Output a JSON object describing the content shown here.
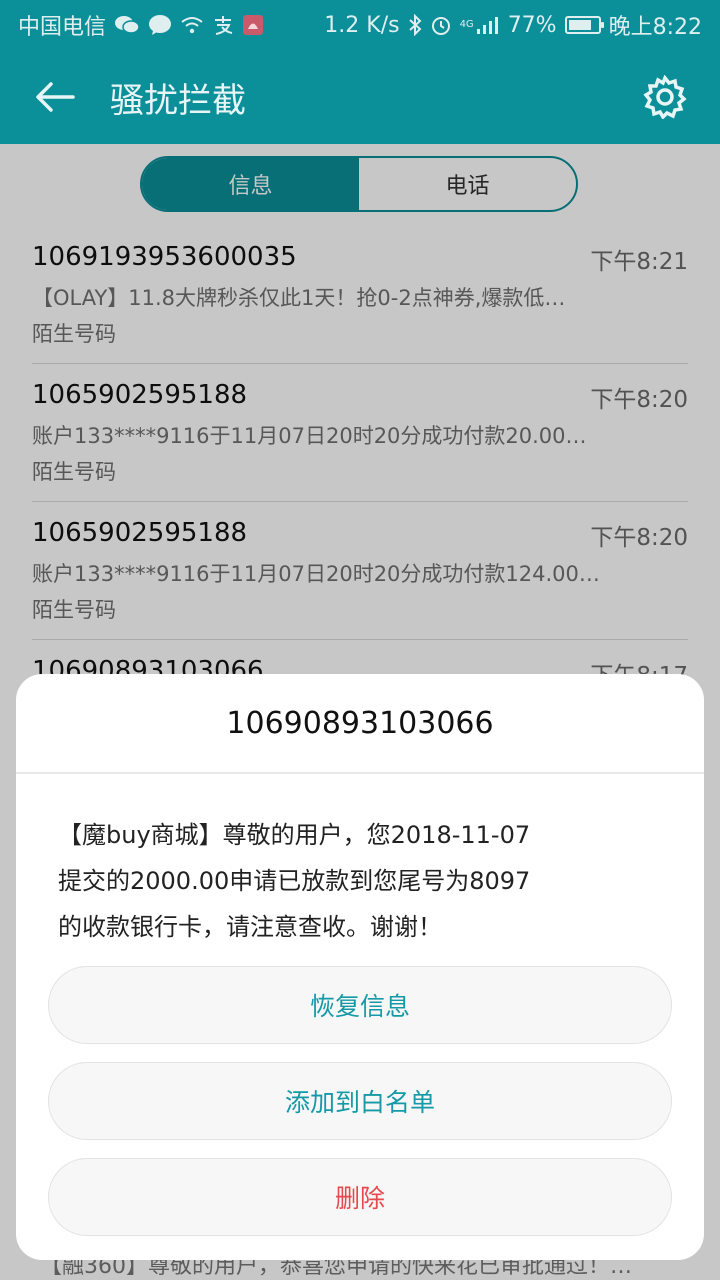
{
  "statusbar": {
    "carrier": "中国电信",
    "net_speed": "1.2 K/s",
    "network": "4G",
    "battery_text": "77%",
    "battery_level": 0.77,
    "time": "晚上8:22"
  },
  "toolbar": {
    "title": "骚扰拦截"
  },
  "tabs": [
    {
      "label": "信息"
    },
    {
      "label": "电话"
    }
  ],
  "list": [
    {
      "number": "1069193953600035",
      "time": "下午8:21",
      "preview": "【OLAY】11.8大牌秒杀仅此1天！抢0-2点神券,爆款低…",
      "tag": "陌生号码"
    },
    {
      "number": "1065902595188",
      "time": "下午8:20",
      "preview": "账户133****9116于11月07日20时20分成功付款20.00…",
      "tag": "陌生号码"
    },
    {
      "number": "1065902595188",
      "time": "下午8:20",
      "preview": "账户133****9116于11月07日20时20分成功付款124.00…",
      "tag": "陌生号码"
    },
    {
      "number": "10690893103066",
      "time": "下午8:17",
      "preview": "",
      "tag": ""
    }
  ],
  "peek_text": "【融360】尊敬的用户，恭喜您申请的快来花已审批通过！…",
  "dialog": {
    "title": "10690893103066",
    "lines": [
      "【魔buy商城】尊敬的用户，您2018-11-07",
      "提交的2000.00申请已放款到您尾号为8097",
      "的收款银行卡，请注意查收。谢谢！"
    ],
    "restore_label": "恢复信息",
    "whitelist_label": "添加到白名单",
    "delete_label": "删除"
  },
  "colors": {
    "accent": "#0b8f99",
    "button_teal": "#1499a6",
    "button_red": "#e5484d"
  }
}
